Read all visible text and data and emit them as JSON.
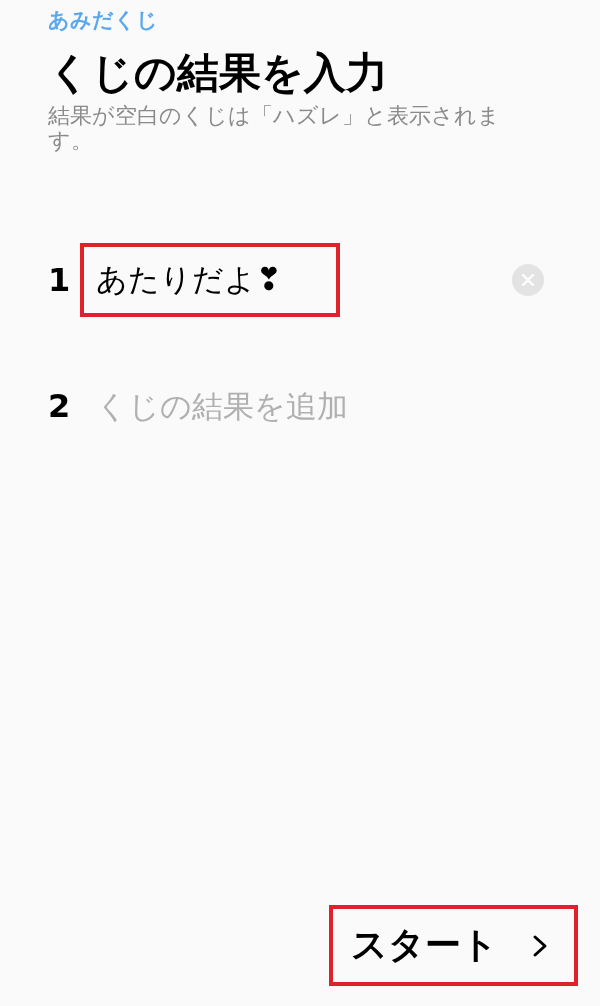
{
  "app_name": "あみだくじ",
  "title": "くじの結果を入力",
  "subtitle": "結果が空白のくじは「ハズレ」と表示されます。",
  "entries": [
    {
      "number": "1",
      "value": "あたりだよ❣",
      "highlighted": true,
      "clearable": true
    },
    {
      "number": "2",
      "placeholder": "くじの結果を追加",
      "highlighted": false,
      "clearable": false
    }
  ],
  "start_button": {
    "label": "スタート",
    "highlighted": true
  }
}
